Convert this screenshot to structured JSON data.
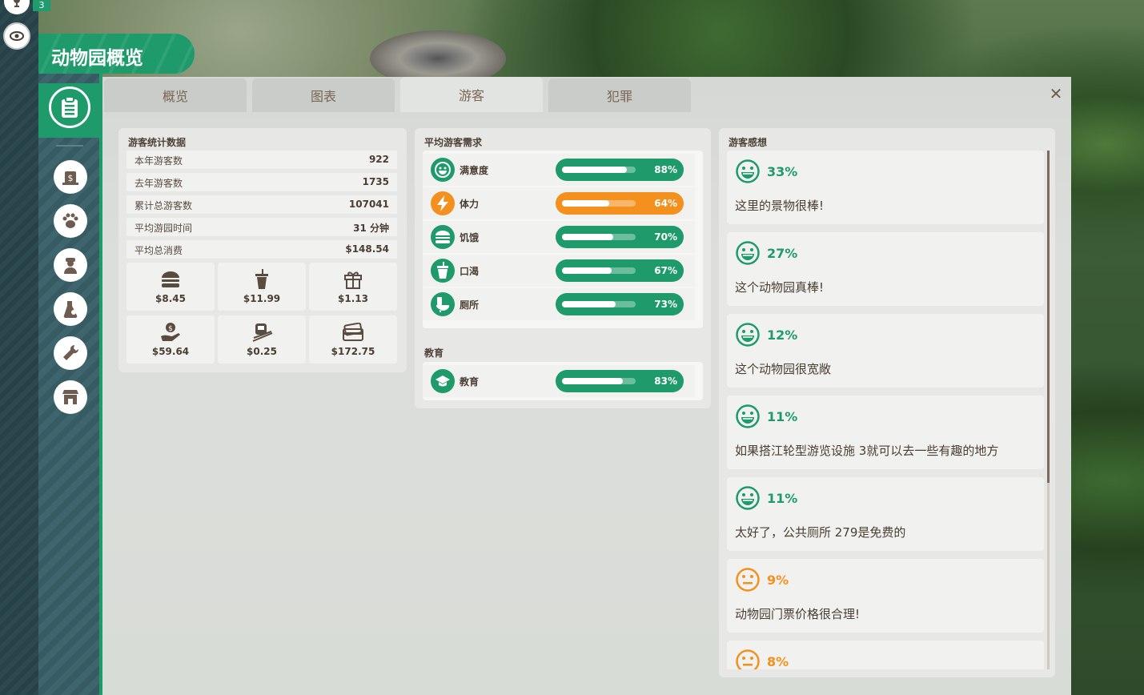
{
  "hud": {
    "trophy_count": "3"
  },
  "banner": {
    "title": "动物园概览"
  },
  "tabs": [
    {
      "label": "概览"
    },
    {
      "label": "图表"
    },
    {
      "label": "游客"
    },
    {
      "label": "犯罪"
    }
  ],
  "active_tab": "游客",
  "close": {
    "label": "✕"
  },
  "guest_stats": {
    "title": "游客统计数据",
    "rows": [
      {
        "label": "本年游客数",
        "value": "922"
      },
      {
        "label": "去年游客数",
        "value": "1735"
      },
      {
        "label": "累计总游客数",
        "value": "107041"
      },
      {
        "label": "平均游园时间",
        "value": "31 分钟"
      },
      {
        "label": "平均总消费",
        "value": "$148.54"
      }
    ],
    "spending": [
      {
        "icon": "burger-icon",
        "value": "$8.45"
      },
      {
        "icon": "drink-cup-icon",
        "value": "$11.99"
      },
      {
        "icon": "gift-icon",
        "value": "$1.13"
      },
      {
        "icon": "donation-hand-icon",
        "value": "$59.64"
      },
      {
        "icon": "train-ride-icon",
        "value": "$0.25"
      },
      {
        "icon": "card-payment-icon",
        "value": "$172.75"
      }
    ]
  },
  "needs": {
    "title": "平均游客需求",
    "items": [
      {
        "icon": "happy-face-icon",
        "label": "满意度",
        "percent": 88,
        "percent_label": "88%",
        "color": "#1e9a6b"
      },
      {
        "icon": "energy-bolt-icon",
        "label": "体力",
        "percent": 64,
        "percent_label": "64%",
        "color": "#f3901e"
      },
      {
        "icon": "hunger-burger-icon",
        "label": "饥饿",
        "percent": 70,
        "percent_label": "70%",
        "color": "#1e9a6b"
      },
      {
        "icon": "thirst-cup-icon",
        "label": "口渴",
        "percent": 67,
        "percent_label": "67%",
        "color": "#1e9a6b"
      },
      {
        "icon": "toilet-icon",
        "label": "厕所",
        "percent": 73,
        "percent_label": "73%",
        "color": "#1e9a6b"
      }
    ]
  },
  "education": {
    "title": "教育",
    "item": {
      "icon": "graduation-cap-icon",
      "label": "教育",
      "percent": 83,
      "percent_label": "83%",
      "color": "#1e9a6b"
    }
  },
  "thoughts": {
    "title": "游客感想",
    "items": [
      {
        "mood": "happy",
        "percent": "33%",
        "text": "这里的景物很棒!"
      },
      {
        "mood": "happy",
        "percent": "27%",
        "text": "这个动物园真棒!"
      },
      {
        "mood": "happy",
        "percent": "12%",
        "text": "这个动物园很宽敞"
      },
      {
        "mood": "happy",
        "percent": "11%",
        "text": "如果搭江轮型游览设施 3就可以去一些有趣的地方"
      },
      {
        "mood": "happy",
        "percent": "11%",
        "text": "太好了，公共厕所 279是免费的"
      },
      {
        "mood": "neutral",
        "percent": "9%",
        "text": "动物园门票价格很合理!"
      },
      {
        "mood": "neutral",
        "percent": "8%",
        "text": ""
      }
    ]
  },
  "colors": {
    "accent": "#1e9a6b",
    "warning": "#f3901e",
    "text": "#4a3d33"
  }
}
